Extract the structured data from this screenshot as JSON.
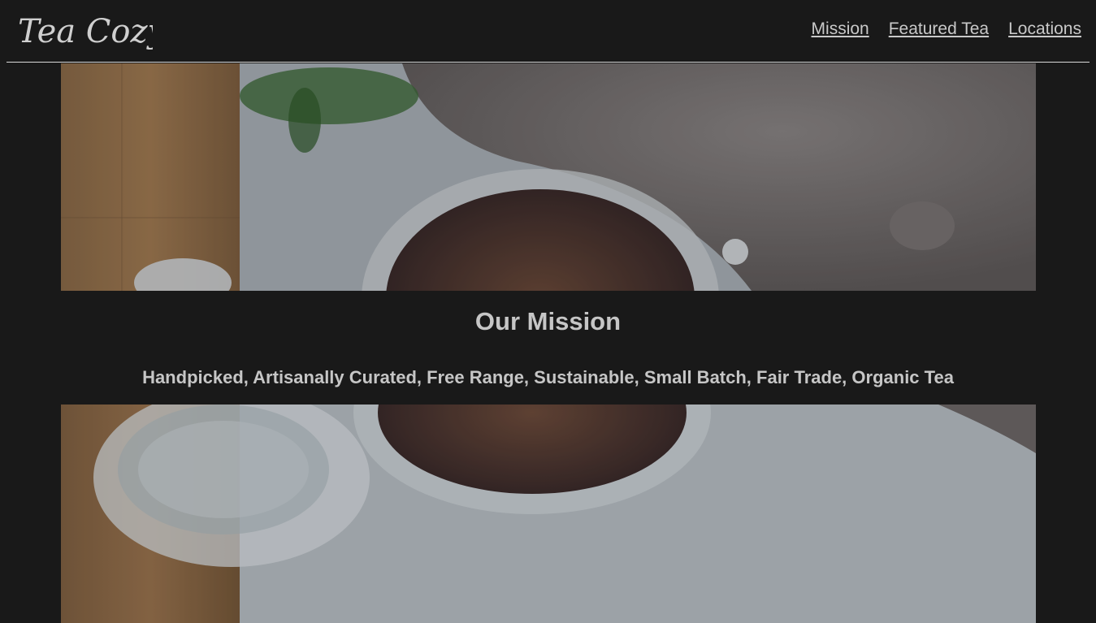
{
  "header": {
    "logo_text": "Tea Cozy",
    "nav": [
      {
        "label": "Mission"
      },
      {
        "label": "Featured Tea"
      },
      {
        "label": "Locations"
      }
    ]
  },
  "mission": {
    "title": "Our Mission",
    "subtitle": "Handpicked, Artisanally Curated, Free Range, Sustainable, Small Batch, Fair Trade, Organic Tea"
  },
  "colors": {
    "background": "#191919",
    "text": "#c6c6c6",
    "divider": "#d9d9d9"
  }
}
